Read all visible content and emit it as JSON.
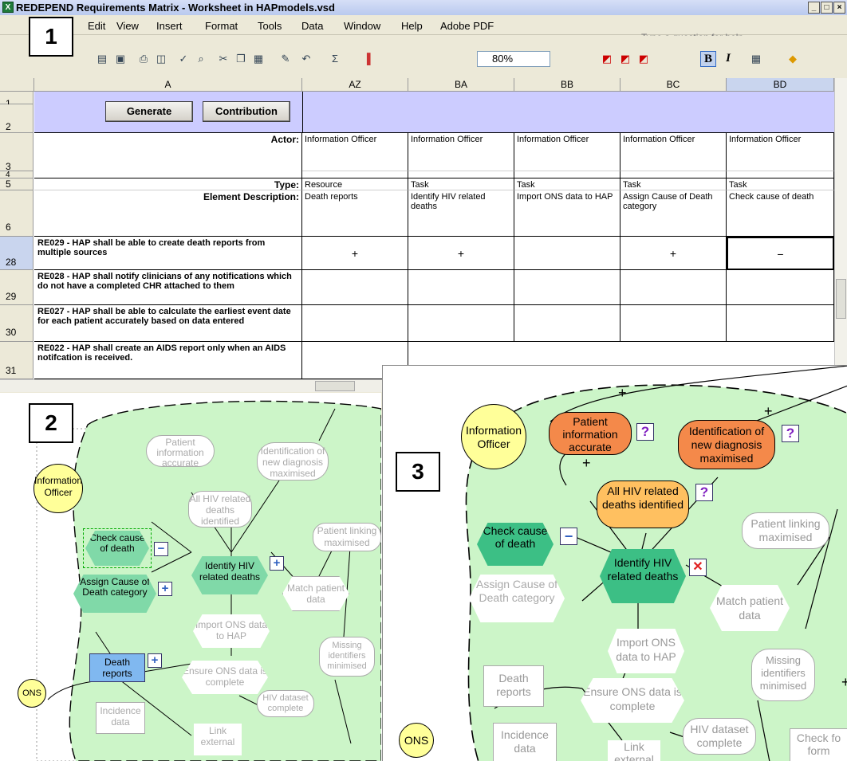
{
  "window": {
    "title": "REDEPEND Requirements Matrix - Worksheet in HAPmodels.vsd",
    "minimize": "_",
    "restore": "□",
    "close": "×"
  },
  "menu": [
    "Edit",
    "View",
    "Insert",
    "Format",
    "Tools",
    "Data",
    "Window",
    "Help",
    "Adobe PDF"
  ],
  "ask_placeholder": "Type a question for help",
  "zoom": "80%",
  "toolbar_icons": [
    "new-icon",
    "open-icon",
    "save-icon",
    "print-icon",
    "preview-icon",
    "spelling-icon",
    "cut-icon",
    "copy-icon",
    "paste-icon",
    "undo-icon",
    "sum-icon",
    "chart-icon",
    "bold-icon",
    "italic-icon",
    "borders-icon",
    "fill-color-icon"
  ],
  "bold_label": "B",
  "italic_label": "I",
  "columns": [
    "A",
    "AZ",
    "BA",
    "BB",
    "BC",
    "BD"
  ],
  "rows": [
    "1",
    "2",
    "3",
    "4",
    "5",
    "6",
    "28",
    "29",
    "30",
    "31"
  ],
  "buttons": {
    "generate": "Generate",
    "contribution": "Contribution"
  },
  "labels": {
    "actor": "Actor:",
    "type": "Type:",
    "element_description": "Element Description:"
  },
  "actor": [
    "Information Officer",
    "Information Officer",
    "Information Officer",
    "Information Officer",
    "Information Officer"
  ],
  "type": [
    "Resource",
    "Task",
    "Task",
    "Task",
    "Task"
  ],
  "description": [
    "Death reports",
    "Identify HIV related deaths",
    "Import ONS data to HAP",
    "Assign Cause of Death category",
    "Check cause of death"
  ],
  "requirements": [
    {
      "text": "RE029 - HAP shall be able to create death reports from multiple sources",
      "marks": [
        "+",
        "+",
        "",
        "+",
        "−"
      ]
    },
    {
      "text": "RE028 - HAP shall notify clinicians of any notifications which do not have a completed CHR attached to them",
      "marks": [
        "",
        "",
        "",
        "",
        ""
      ]
    },
    {
      "text": "RE027 - HAP shall be able to calculate the earliest event date for each patient accurately based on data entered",
      "marks": [
        "",
        "",
        "",
        "",
        ""
      ]
    },
    {
      "text": "RE022 - HAP shall create an AIDS report only when an AIDS notifcation is received.",
      "marks": [
        "",
        "",
        "",
        "",
        ""
      ]
    }
  ],
  "panel_numbers": [
    "1",
    "2",
    "3"
  ],
  "diagram": {
    "actor": "Information Officer",
    "ons": "ONS",
    "nodes": {
      "patient_info": "Patient information accurate",
      "identification": "Identification of new diagnosis maximised",
      "all_hiv": "All HIV related deaths identified",
      "patient_linking": "Patient linking maximised",
      "check_cause": "Check cause of death",
      "identify_hiv": "Identify HIV related deaths",
      "assign_cause": "Assign Cause of Death category",
      "match": "Match patient data",
      "import_ons": "Import ONS data to HAP",
      "death_reports": "Death reports",
      "missing_ids": "Missing identifiers minimised",
      "ensure_ons": "Ensure ONS data is complete",
      "incidence": "Incidence data",
      "link": "Link external",
      "hiv_dataset": "HIV dataset complete",
      "check_form": "Check fo form"
    },
    "badges": {
      "plus": "+",
      "minus": "−",
      "question": "?",
      "cross": "✕"
    }
  }
}
